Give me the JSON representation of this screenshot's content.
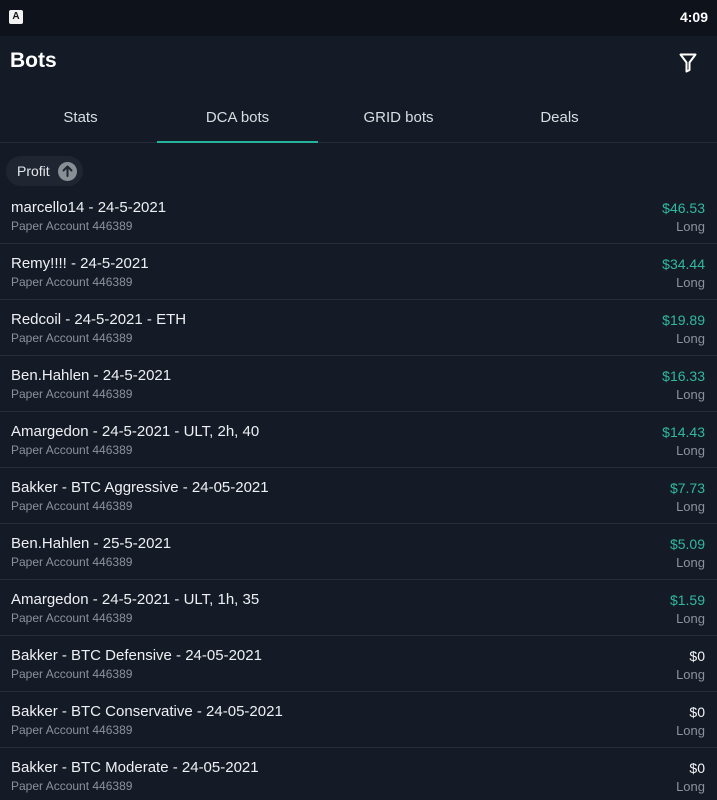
{
  "status_bar": {
    "app_icon": "A",
    "time": "4:09"
  },
  "header": {
    "title": "Bots",
    "filter_icon": "filter-icon"
  },
  "tabs": [
    {
      "label": "Stats",
      "active": false
    },
    {
      "label": "DCA bots",
      "active": true
    },
    {
      "label": "GRID bots",
      "active": false
    },
    {
      "label": "Deals",
      "active": false
    }
  ],
  "sort": {
    "label": "Profit",
    "direction_icon": "arrow-up-icon"
  },
  "colors": {
    "accent": "#25b39e",
    "positive": "#30b8a1",
    "background": "#151b26"
  },
  "bots": [
    {
      "name": "marcello14 - 24-5-2021",
      "account": "Paper Account 446389",
      "profit": "$46.53",
      "side": "Long",
      "zero": false
    },
    {
      "name": "Remy!!!! - 24-5-2021",
      "account": "Paper Account 446389",
      "profit": "$34.44",
      "side": "Long",
      "zero": false
    },
    {
      "name": "Redcoil - 24-5-2021 - ETH",
      "account": "Paper Account 446389",
      "profit": "$19.89",
      "side": "Long",
      "zero": false
    },
    {
      "name": "Ben.Hahlen - 24-5-2021",
      "account": "Paper Account 446389",
      "profit": "$16.33",
      "side": "Long",
      "zero": false
    },
    {
      "name": "Amargedon - 24-5-2021 - ULT, 2h, 40",
      "account": "Paper Account 446389",
      "profit": "$14.43",
      "side": "Long",
      "zero": false
    },
    {
      "name": "Bakker - BTC Aggressive - 24-05-2021",
      "account": "Paper Account 446389",
      "profit": "$7.73",
      "side": "Long",
      "zero": false
    },
    {
      "name": "Ben.Hahlen - 25-5-2021",
      "account": "Paper Account 446389",
      "profit": "$5.09",
      "side": "Long",
      "zero": false
    },
    {
      "name": "Amargedon - 24-5-2021 - ULT, 1h, 35",
      "account": "Paper Account 446389",
      "profit": "$1.59",
      "side": "Long",
      "zero": false
    },
    {
      "name": "Bakker - BTC Defensive - 24-05-2021",
      "account": "Paper Account 446389",
      "profit": "$0",
      "side": "Long",
      "zero": true
    },
    {
      "name": "Bakker - BTC Conservative - 24-05-2021",
      "account": "Paper Account 446389",
      "profit": "$0",
      "side": "Long",
      "zero": true
    },
    {
      "name": "Bakker - BTC Moderate - 24-05-2021",
      "account": "Paper Account 446389",
      "profit": "$0",
      "side": "Long",
      "zero": true
    }
  ]
}
